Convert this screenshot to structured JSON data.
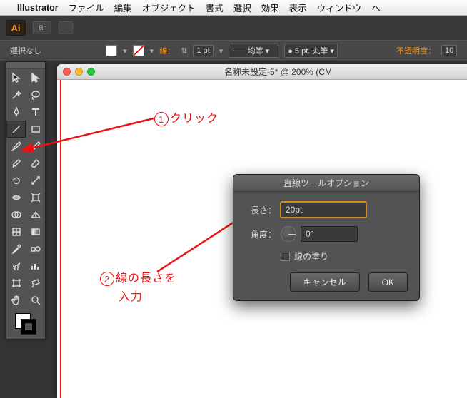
{
  "menu": {
    "app": "Illustrator",
    "items": [
      "ファイル",
      "編集",
      "オブジェクト",
      "書式",
      "選択",
      "効果",
      "表示",
      "ウィンドウ",
      "ヘ"
    ]
  },
  "app_badge": "Ai",
  "ctrl": {
    "no_selection": "選択なし",
    "stroke_label": "線：",
    "stroke_weight": "1 pt",
    "profile": "均等",
    "brush": "5 pt. 丸筆",
    "opacity_label": "不透明度：",
    "opacity_value": "10"
  },
  "doc": {
    "title": "名称未設定-5* @ 200% (CM"
  },
  "dialog": {
    "title": "直線ツールオプション",
    "length_label": "長さ：",
    "length_value": "20pt",
    "angle_label": "角度：",
    "angle_value": "0°",
    "fill_label": "線の塗り",
    "cancel": "キャンセル",
    "ok": "OK"
  },
  "annotations": {
    "a1_num": "1",
    "a1_text": "クリック",
    "a2_num": "2",
    "a2_line1": "線の長さを",
    "a2_line2": "入力"
  },
  "tool_names": [
    [
      "selection",
      "direct-selection"
    ],
    [
      "magic-wand",
      "lasso"
    ],
    [
      "pen",
      "type"
    ],
    [
      "line-segment",
      "rectangle"
    ],
    [
      "paintbrush",
      "pencil"
    ],
    [
      "blob-brush",
      "eraser"
    ],
    [
      "rotate",
      "scale"
    ],
    [
      "width",
      "free-transform"
    ],
    [
      "shape-builder",
      "perspective-grid"
    ],
    [
      "mesh",
      "gradient"
    ],
    [
      "eyedropper",
      "blend"
    ],
    [
      "symbol-sprayer",
      "column-graph"
    ],
    [
      "artboard",
      "slice"
    ],
    [
      "hand",
      "zoom"
    ]
  ],
  "selected_tool": "line-segment"
}
